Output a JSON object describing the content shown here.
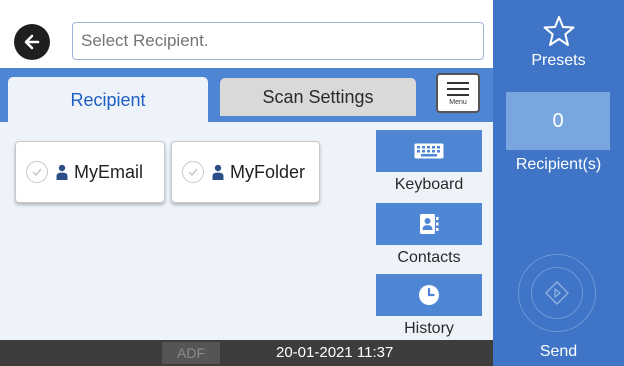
{
  "header": {
    "search_placeholder": "Select Recipient."
  },
  "tabs": {
    "recipient": "Recipient",
    "scan_settings": "Scan Settings",
    "menu": "Menu"
  },
  "destinations": [
    {
      "label": "MyEmail"
    },
    {
      "label": "MyFolder"
    }
  ],
  "side_buttons": {
    "keyboard": "Keyboard",
    "contacts": "Contacts",
    "history": "History"
  },
  "status": {
    "adf": "ADF",
    "datetime": "20-01-2021 11:37"
  },
  "right_panel": {
    "presets": "Presets",
    "recipient_count": "0",
    "recipients_label": "Recipient(s)",
    "send": "Send"
  },
  "icons": {
    "back": "back-arrow-icon",
    "star": "star-icon",
    "keyboard": "keyboard-icon",
    "contacts": "contacts-icon",
    "history": "clock-icon",
    "send": "send-diamond-icon"
  },
  "colors": {
    "accent": "#4e86d4",
    "right_panel": "#3f74c6",
    "count_box": "#7aa6e0",
    "status_bar": "#3d3d3d"
  }
}
